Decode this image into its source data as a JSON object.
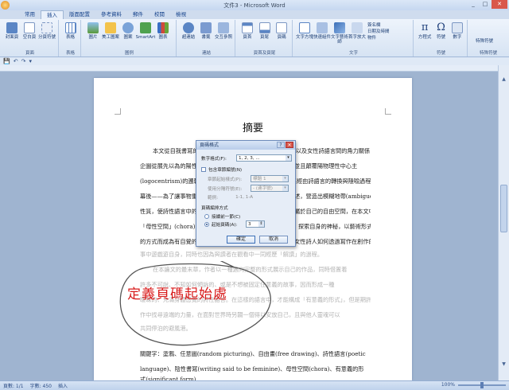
{
  "window": {
    "title": "文件3 - Microsoft Word",
    "controls": [
      "_",
      "□",
      "✕"
    ]
  },
  "tabs": [
    {
      "label": "常用",
      "active": false
    },
    {
      "label": "插入",
      "active": true
    },
    {
      "label": "版面配置",
      "active": false
    },
    {
      "label": "參考資料",
      "active": false
    },
    {
      "label": "郵件",
      "active": false
    },
    {
      "label": "校閱",
      "active": false
    },
    {
      "label": "檢視",
      "active": false
    }
  ],
  "ribbon": {
    "groups": [
      {
        "label": "頁面",
        "buttons": [
          "封面頁",
          "空白頁",
          "分頁符號"
        ]
      },
      {
        "label": "表格",
        "buttons": [
          "表格"
        ]
      },
      {
        "label": "圖例",
        "buttons": [
          "圖片",
          "美工圖案",
          "圖案",
          "SmartArt",
          "圖表"
        ]
      },
      {
        "label": "連結",
        "buttons": [
          "超連結",
          "書籤",
          "交互參照"
        ]
      },
      {
        "label": "頁首及頁尾",
        "buttons": [
          "頁首",
          "頁尾",
          "頁碼"
        ]
      },
      {
        "label": "文字",
        "buttons": [
          "文字方塊",
          "快速組件",
          "文字藝術師",
          "首字放大"
        ],
        "small": [
          "簽名欄",
          "日期及時間",
          "物件"
        ]
      },
      {
        "label": "符號",
        "buttons": [
          "方程式",
          "符號",
          "數字"
        ]
      },
      {
        "label": "特殊符號",
        "small": [
          "特殊符號"
        ]
      }
    ]
  },
  "quick_access": [
    "💾",
    "↶",
    "↷",
    "▾"
  ],
  "document": {
    "title": "摘要",
    "lines": [
      "本文從自我書寫的角度，探討女性書寫與身體之間的關係以及女性詩語言間的角力關係，",
      "企圖從展先以為的陽性詩學觀點中，尋找出女性主體的聲音，並且顛覆陽物理性中心主",
      "(logocentrism)的邏輯，從詩人的自我身分認同出發，探究其經由詩語言的轉換與隱喻過程，",
      "幕後——為了讓事物重新被命名，寫作者透過曖昧性的語言描述，營造出模糊地帶(ambiguous)",
      "性質，使詩性語言中的意義得以延異，女性在語言中找到一個屬於自己的自由空間，在本文中稱作",
      "「母性空間」(chora)，在其中能夠展現屬於女性獨有的慾望，探索自身的神秘，以藝術形式實踐",
      "的方式而成為有自覺的主體。本文以筆記與書寫為主軸，分析女性詩人如何透過寫作在創作的過程中",
      "事中遊戲遊自身，同時也因為與讀者在觀看中一同經歷「解讀」的過程。",
      "在本論文的最末章，作者以一種邁向完整的形式展示自己的作品，同時借置着",
      "許多不可說、不知如何傾訴的、或是不想被固定住意義的故事，因而形成一種",
      "曖昧的、充滿身體感覺的詩性語言。在這樣的語言中，才能構成「有意義的形式」，但是期許在創",
      "作中找尋遠端的力量，在面對世界時另闢一個得以安放自己，且與他人靈魂可以",
      "共同停泊的避風港。",
      "關鍵字：塗鴉、任意圖(random picturing)、自由畫(free drawing)、詩性語言(poetic",
      "language)、陰性書寫(writing said to be feminine)、母性空間(chora)、有意義的形",
      "式(significant form)"
    ]
  },
  "dialog": {
    "title": "頁碼格式",
    "number_format_label": "數字格式(F):",
    "number_format_value": "1, 2, 3, ...",
    "include_chapter_label": "包含章節編號(N)",
    "chapter_style_label": "章節起始樣式(P):",
    "chapter_style_value": "標題 1",
    "separator_label": "使用分隔符號(E):",
    "separator_value": "- (連字號)",
    "example_label": "範例:",
    "example_value": "1-1, 1-A",
    "numbering_label": "頁碼編排方式",
    "continue_label": "接續前一節(C)",
    "start_at_label": "起始頁碼(A):",
    "start_at_value": "3",
    "ok_label": "確定",
    "cancel_label": "取消"
  },
  "callout": {
    "text": "定義頁碼起始處",
    "color": "#d81a1a"
  },
  "status": {
    "page": "頁數: 1/1",
    "words": "字數: 450",
    "mode": "插入",
    "zoom": "100%"
  }
}
